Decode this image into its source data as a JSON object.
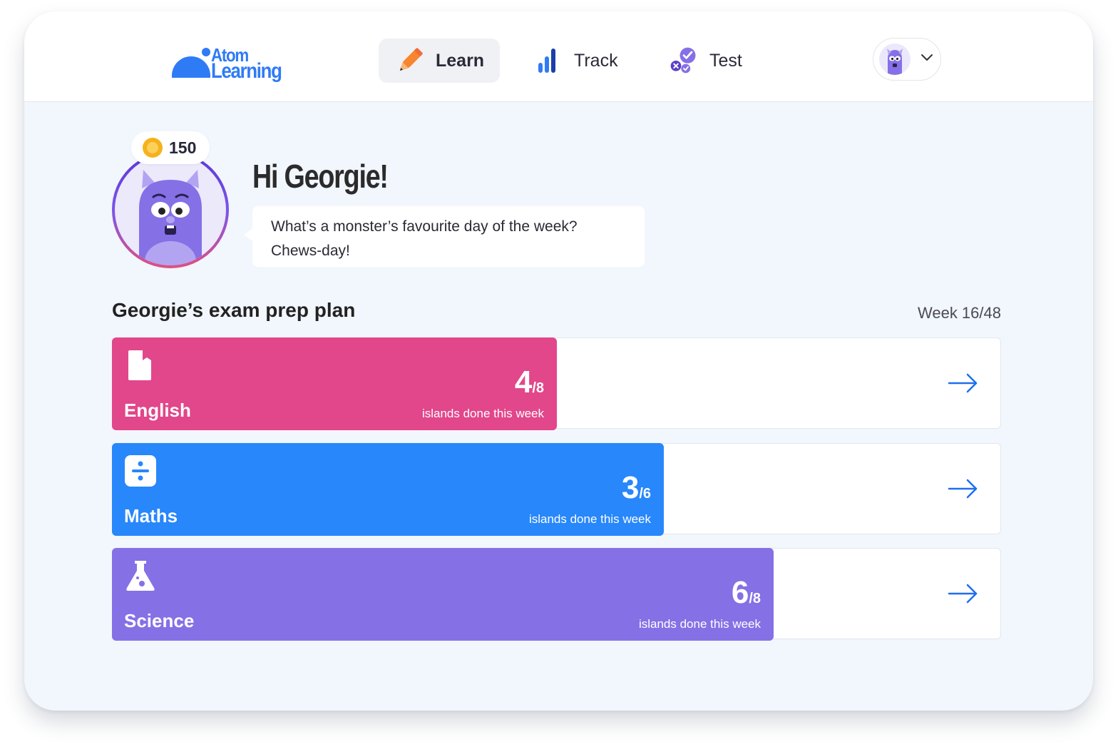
{
  "app": {
    "logo_line1": "Atom",
    "logo_line2": "Learning",
    "brand_color": "#2f7bf6"
  },
  "nav": {
    "items": [
      {
        "label": "Learn",
        "icon": "pencil-icon",
        "active": true
      },
      {
        "label": "Track",
        "icon": "bar-chart-icon",
        "active": false
      },
      {
        "label": "Test",
        "icon": "test-check-icon",
        "active": false
      }
    ],
    "profile_icon": "monster-avatar-icon",
    "dropdown_icon": "chevron-down-icon"
  },
  "profile": {
    "coins": "150",
    "coin_icon": "coin-icon",
    "greeting": "Hi Georgie!",
    "joke_line1": "What’s a monster’s favourite day of the week?",
    "joke_line2": "Chews-day!"
  },
  "plan": {
    "title": "Georgie’s exam prep plan",
    "week": "Week 16/48",
    "subjects": [
      {
        "name": "English",
        "icon": "book-icon",
        "done": "4",
        "total": "/8",
        "caption": "islands done this week",
        "progress": 0.5,
        "color": "#e2468b"
      },
      {
        "name": "Maths",
        "icon": "divide-icon",
        "done": "3",
        "total": "/6",
        "caption": "islands done this week",
        "progress": 0.5,
        "color": "#2787fb"
      },
      {
        "name": "Science",
        "icon": "flask-icon",
        "done": "6",
        "total": "/8",
        "caption": "islands done this week",
        "progress": 0.75,
        "color": "#8670e6"
      }
    ],
    "arrow_icon": "arrow-right-icon"
  }
}
